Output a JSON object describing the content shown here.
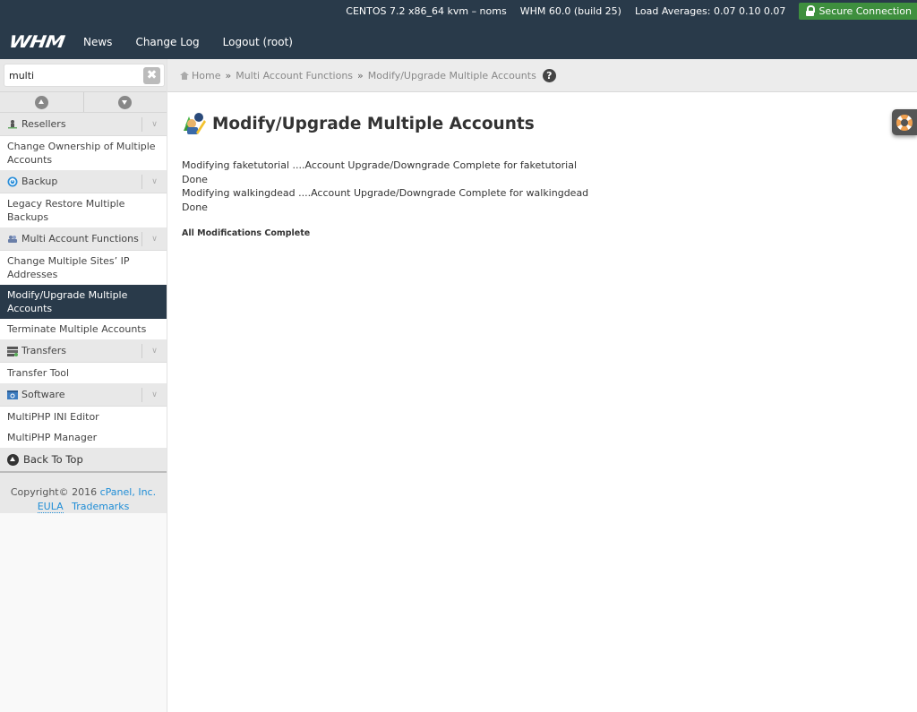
{
  "header": {
    "system_info": "CENTOS 7.2 x86_64 kvm – noms",
    "version": "WHM 60.0 (build 25)",
    "load_averages": "Load Averages: 0.07 0.10 0.07",
    "secure_connection": "Secure Connection",
    "logo": "WHM",
    "nav": [
      {
        "label": "News"
      },
      {
        "label": "Change Log"
      },
      {
        "label": "Logout (root)"
      }
    ]
  },
  "sidebar": {
    "search": {
      "value": "multi",
      "placeholder": ""
    },
    "categories": [
      {
        "label": "Resellers",
        "icon": "resellers-icon",
        "items": [
          "Change Ownership of Multiple Accounts"
        ]
      },
      {
        "label": "Backup",
        "icon": "backup-icon",
        "items": [
          "Legacy Restore Multiple Backups"
        ]
      },
      {
        "label": "Multi Account Functions",
        "icon": "multi-account-icon",
        "items": [
          "Change Multiple Sites’ IP Addresses",
          "Modify/Upgrade Multiple Accounts",
          "Terminate Multiple Accounts"
        ]
      },
      {
        "label": "Transfers",
        "icon": "transfers-icon",
        "items": [
          "Transfer Tool"
        ]
      },
      {
        "label": "Software",
        "icon": "software-icon",
        "items": [
          "MultiPHP INI Editor",
          "MultiPHP Manager"
        ]
      }
    ],
    "active_item": "Modify/Upgrade Multiple Accounts",
    "back_to_top": "Back To Top",
    "footer": {
      "copyright": "Copyright© 2016",
      "company": "cPanel, Inc.",
      "eula": "EULA",
      "trademarks": "Trademarks"
    }
  },
  "breadcrumb": {
    "items": [
      "Home",
      "Multi Account Functions",
      "Modify/Upgrade Multiple Accounts"
    ],
    "separator": "»"
  },
  "main": {
    "title": "Modify/Upgrade Multiple Accounts",
    "log": [
      "Modifying faketutorial ....Account Upgrade/Downgrade Complete for faketutorial",
      "Done",
      "Modifying walkingdead ....Account Upgrade/Downgrade Complete for walkingdead",
      "Done"
    ],
    "summary": "All Modifications Complete"
  },
  "colors": {
    "header_bg": "#293a4a",
    "secure_green": "#3e8f3e",
    "link_blue": "#1f8dd6"
  }
}
